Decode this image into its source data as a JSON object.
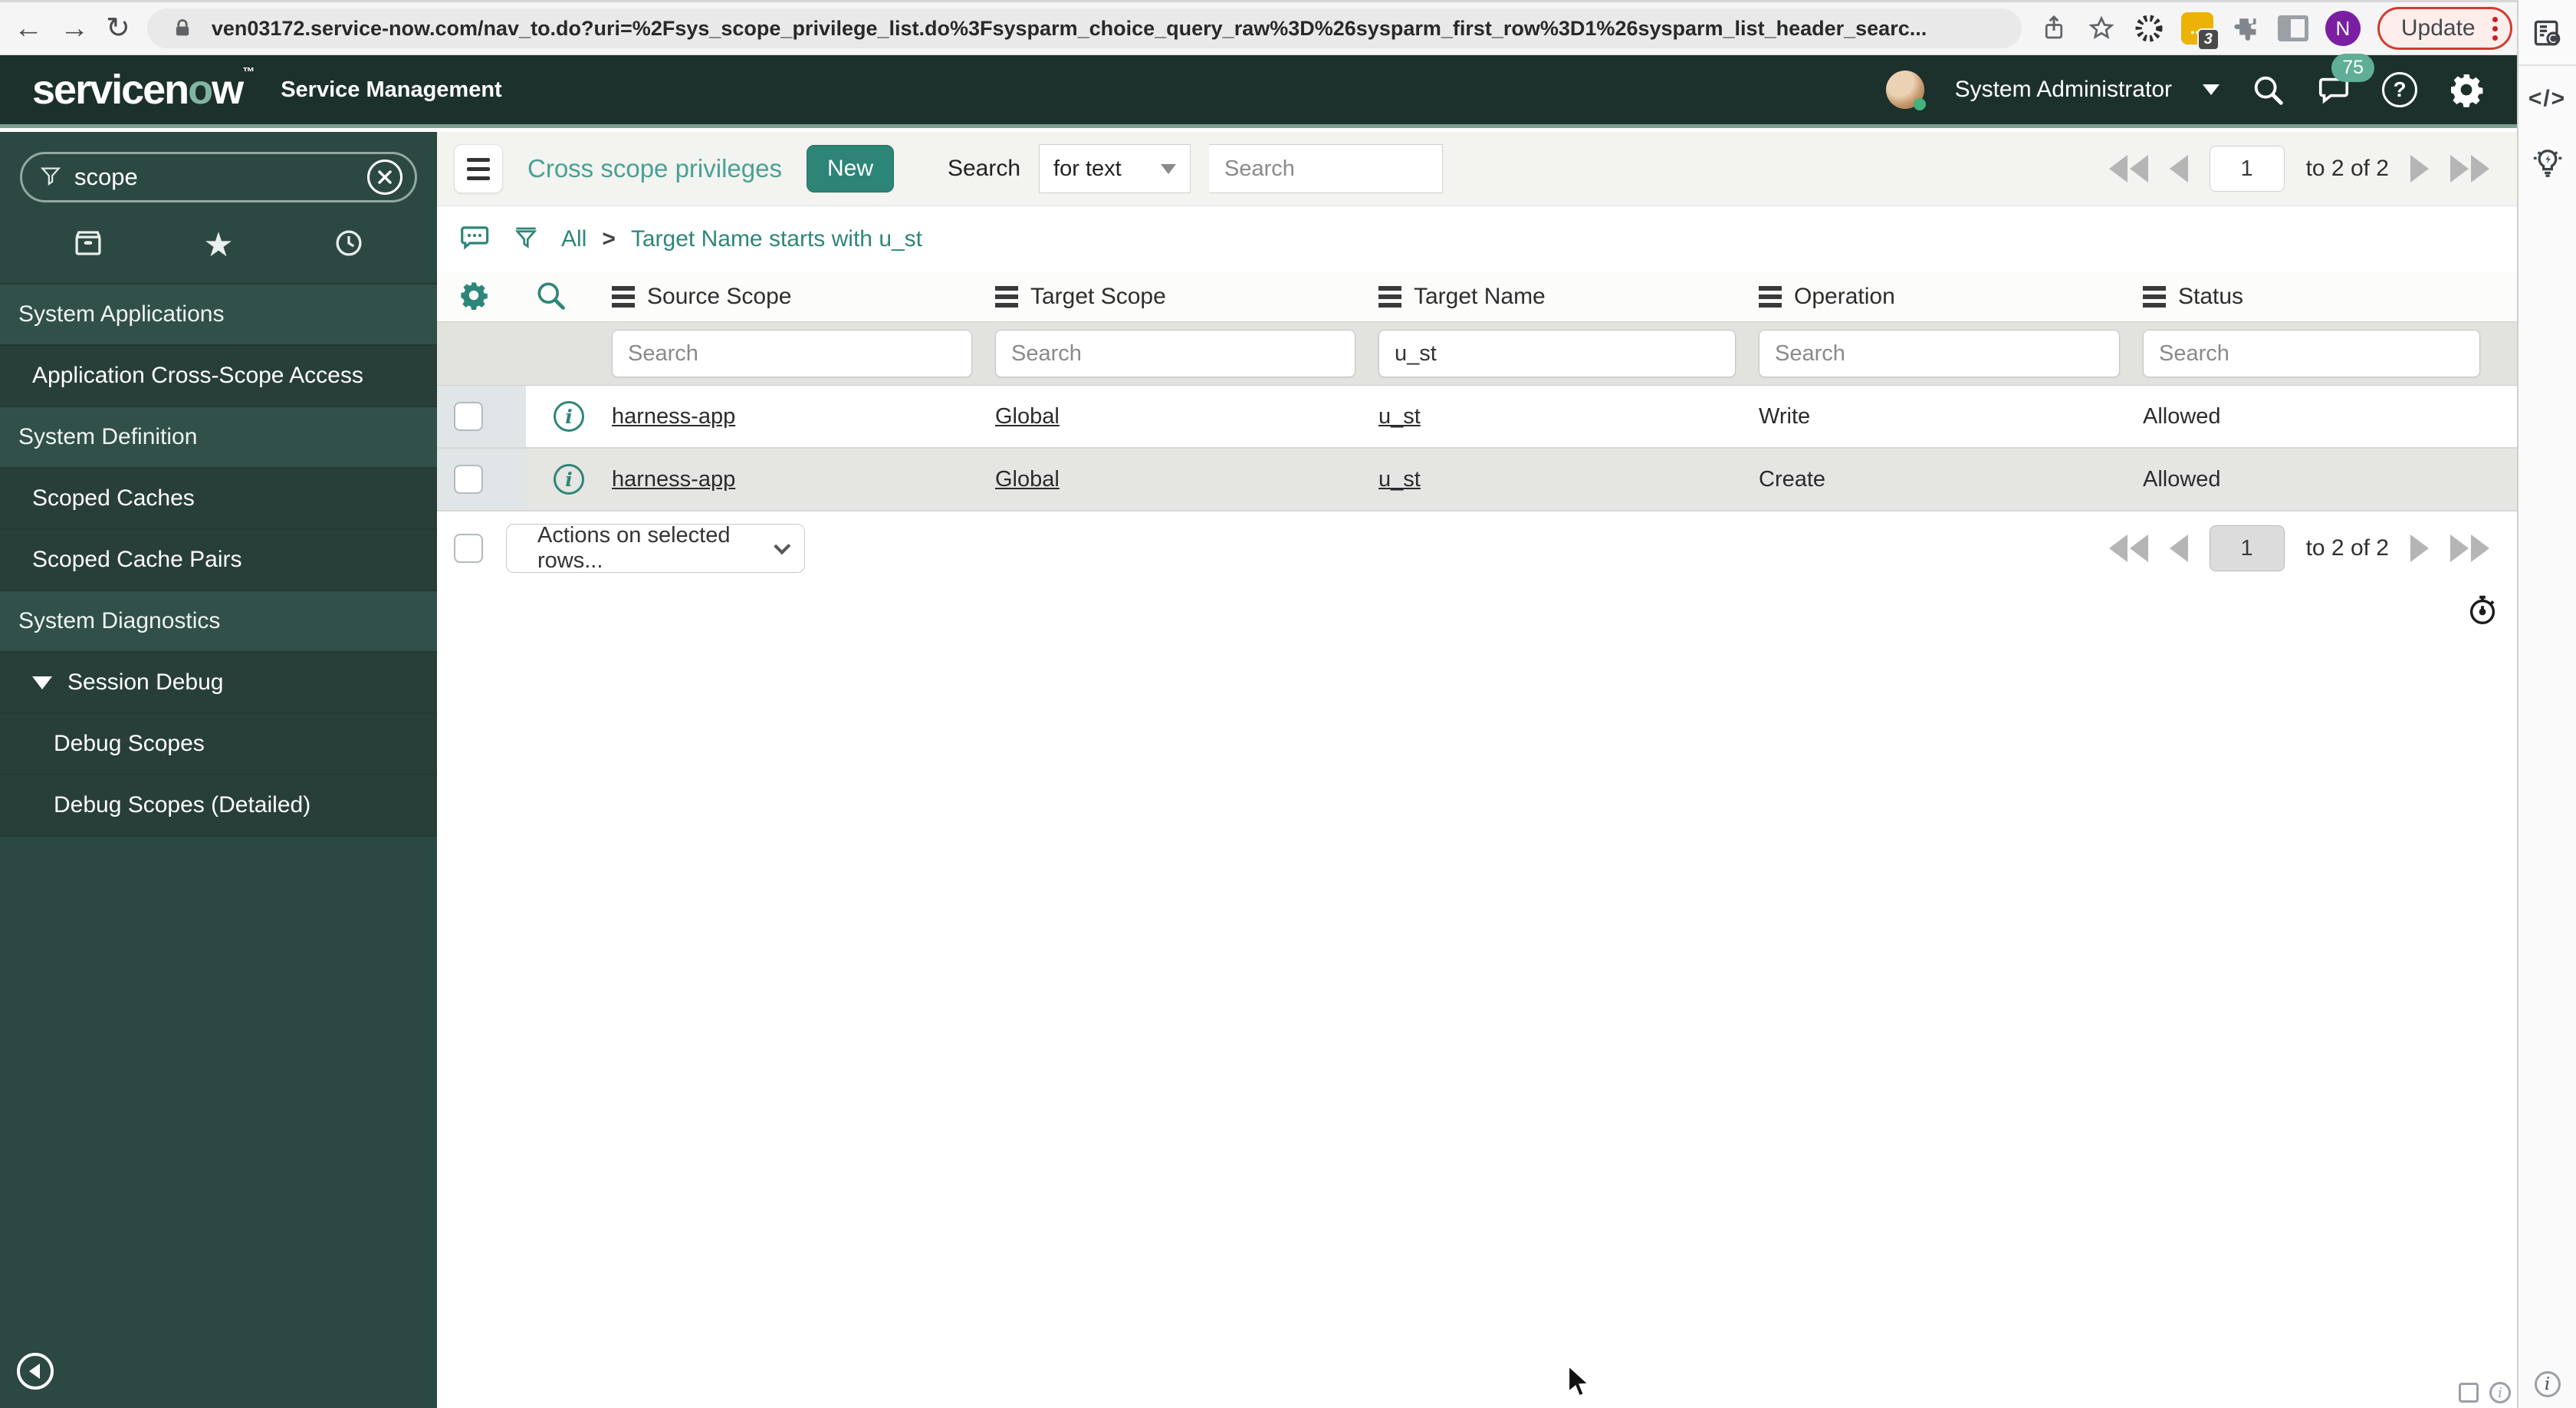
{
  "browser": {
    "url": "ven03172.service-now.com/nav_to.do?uri=%2Fsys_scope_privilege_list.do%3Fsysparm_choice_query_raw%3D%26sysparm_first_row%3D1%26sysparm_list_header_searc...",
    "extension_badge": "3",
    "profile_initial": "N",
    "update_label": "Update"
  },
  "icons": {
    "back": "←",
    "forward": "→",
    "reload": "↻",
    "star": "★",
    "help": "?",
    "code": "</>",
    "ellipsis": "...",
    "info": "i"
  },
  "app_header": {
    "logo_left": "servicen",
    "logo_o": "o",
    "logo_right": "w",
    "logo_tm": "™",
    "product": "Service Management",
    "user": "System Administrator",
    "notification_count": "75"
  },
  "sidebar": {
    "search_value": "scope",
    "items": [
      {
        "label": "System Applications",
        "type": "section"
      },
      {
        "label": "Application Cross-Scope Access",
        "type": "item"
      },
      {
        "label": "System Definition",
        "type": "section"
      },
      {
        "label": "Scoped Caches",
        "type": "item"
      },
      {
        "label": "Scoped Cache Pairs",
        "type": "item"
      },
      {
        "label": "System Diagnostics",
        "type": "section"
      },
      {
        "label": "Session Debug",
        "type": "group-expanded"
      },
      {
        "label": "Debug Scopes",
        "type": "subitem"
      },
      {
        "label": "Debug Scopes (Detailed)",
        "type": "subitem"
      }
    ]
  },
  "content": {
    "title": "Cross scope privileges",
    "new_button": "New",
    "search_label": "Search",
    "search_type": "for text",
    "search_placeholder": "Search",
    "breadcrumb": {
      "all": "All",
      "sep": ">",
      "filter": "Target Name starts with u_st"
    },
    "table": {
      "columns": [
        "Source Scope",
        "Target Scope",
        "Target Name",
        "Operation",
        "Status"
      ],
      "filter_placeholder": "Search",
      "target_name_filter": "u_st",
      "rows": [
        {
          "source_scope": "harness-app",
          "target_scope": "Global",
          "target_name": "u_st",
          "operation": "Write",
          "status": "Allowed"
        },
        {
          "source_scope": "harness-app",
          "target_scope": "Global",
          "target_name": "u_st",
          "operation": "Create",
          "status": "Allowed"
        }
      ]
    },
    "actions_select": "Actions on selected rows...",
    "pagination": {
      "page": "1",
      "range": "to 2 of 2"
    }
  },
  "colors": {
    "header_bg": "#1d312c",
    "sidebar_bg": "#2c4842",
    "accent_teal": "#2e8678",
    "title_teal": "#49a093",
    "header_underline": "#7e9f90",
    "notification_badge": "#5fae97",
    "update_border": "#d23b2f",
    "row_alt": "#e5e5e2"
  }
}
